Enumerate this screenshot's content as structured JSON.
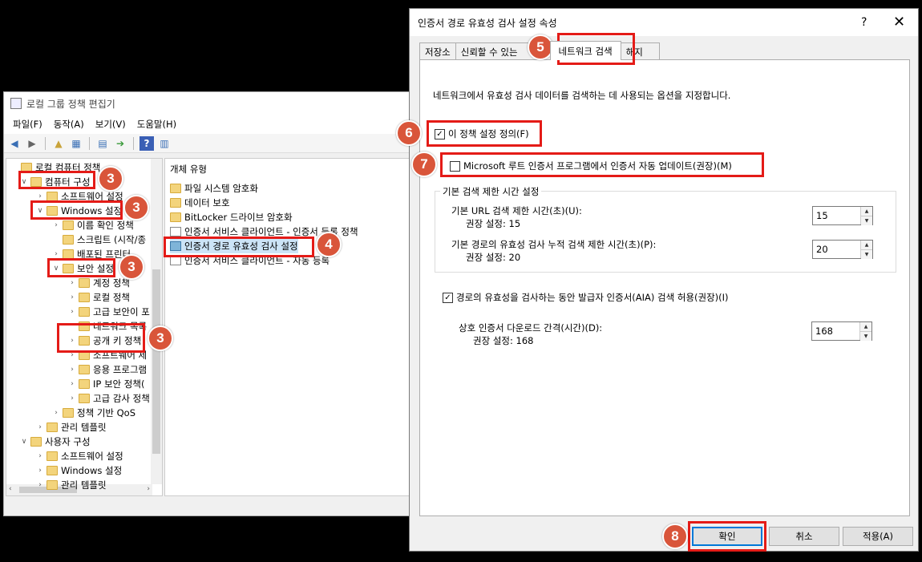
{
  "gpe": {
    "title": "로컬 그룹 정책 편집기",
    "menu": [
      "파일(F)",
      "동작(A)",
      "보기(V)",
      "도움말(H)"
    ],
    "tree": [
      {
        "label": "로컬 컴퓨터 정책",
        "level": 0,
        "arrow": ""
      },
      {
        "label": "컴퓨터 구성",
        "level": 1,
        "arrow": "∨"
      },
      {
        "label": "소프트웨어 설정",
        "level": 2,
        "arrow": "›"
      },
      {
        "label": "Windows 설정",
        "level": 2,
        "arrow": "∨"
      },
      {
        "label": "이름 확인 정책",
        "level": 3,
        "arrow": "›"
      },
      {
        "label": "스크립트 (시작/종",
        "level": 3,
        "arrow": ""
      },
      {
        "label": "배포된 프린터",
        "level": 3,
        "arrow": "›"
      },
      {
        "label": "보안 설정",
        "level": 3,
        "arrow": "∨"
      },
      {
        "label": "계정 정책",
        "level": 4,
        "arrow": "›"
      },
      {
        "label": "로컬 정책",
        "level": 4,
        "arrow": "›"
      },
      {
        "label": "고급 보안이 포",
        "level": 4,
        "arrow": "›"
      },
      {
        "label": "네트워크 목록",
        "level": 4,
        "arrow": ""
      },
      {
        "label": "공개 키 정책",
        "level": 4,
        "arrow": "›"
      },
      {
        "label": "소프트웨어 제",
        "level": 4,
        "arrow": "›"
      },
      {
        "label": "응용 프로그램",
        "level": 4,
        "arrow": "›"
      },
      {
        "label": "IP 보안 정책(",
        "level": 4,
        "arrow": "›"
      },
      {
        "label": "고급 감사 정책",
        "level": 4,
        "arrow": "›"
      },
      {
        "label": "정책 기반 QoS",
        "level": 3,
        "arrow": "›"
      },
      {
        "label": "관리 템플릿",
        "level": 2,
        "arrow": "›"
      },
      {
        "label": "사용자 구성",
        "level": 1,
        "arrow": "∨"
      },
      {
        "label": "소프트웨어 설정",
        "level": 2,
        "arrow": "›"
      },
      {
        "label": "Windows 설정",
        "level": 2,
        "arrow": "›"
      },
      {
        "label": "관리 템플릿",
        "level": 2,
        "arrow": "›"
      }
    ],
    "list_header": "개체 유형",
    "list": [
      {
        "label": "파일 시스템 암호화",
        "icon": "folder"
      },
      {
        "label": "데이터 보호",
        "icon": "folder"
      },
      {
        "label": "BitLocker 드라이브 암호화",
        "icon": "folder"
      },
      {
        "label": "인증서 서비스 클라이언트 - 인증서 등록 정책",
        "icon": "doc"
      },
      {
        "label": "인증서 경로 유효성 검사 설정",
        "icon": "cert"
      },
      {
        "label": "인증서 서비스 클라이언트 - 자동 등록",
        "icon": "doc"
      }
    ]
  },
  "dialog": {
    "title": "인증서 경로 유효성 검사 설정 속성",
    "help": "?",
    "close": "✕",
    "tabs": [
      "저장소",
      "신뢰할 수 있는",
      "네트워크 검색",
      "해지"
    ],
    "description": "네트워크에서 유효성 검사 데이터를 검색하는 데 사용되는 옵션을 지정합니다.",
    "define_policy": {
      "label": "이 정책 설정 정의(F)",
      "checked": true
    },
    "ms_root_update": {
      "label": "Microsoft 루트 인증서 프로그램에서 인증서 자동 업데이트(권장)(M)",
      "checked": false
    },
    "timeout_group": "기본 검색 제한 시간 설정",
    "url_timeout": {
      "label": "기본 URL 검색 제한 시간(초)(U):",
      "rec": "권장 설정: 15",
      "value": "15"
    },
    "path_timeout": {
      "label": "기본 경로의 유효성 검사 누적 검색 제한 시간(초)(P):",
      "rec": "권장 설정: 20",
      "value": "20"
    },
    "aia": {
      "label": "경로의 유효성을 검사하는 동안 발급자 인증서(AIA) 검색 허용(권장)(I)",
      "checked": true
    },
    "cross_cert": {
      "label": "상호 인증서 다운로드 간격(시간)(D):",
      "rec": "권장 설정: 168",
      "value": "168"
    },
    "buttons": {
      "ok": "확인",
      "cancel": "취소",
      "apply": "적용(A)"
    }
  },
  "badges": [
    "3",
    "3",
    "3",
    "3",
    "4",
    "5",
    "6",
    "7",
    "8"
  ],
  "colors": {
    "highlight": "#e41b17",
    "badge": "#d9553a",
    "selection": "#cce4f7"
  }
}
